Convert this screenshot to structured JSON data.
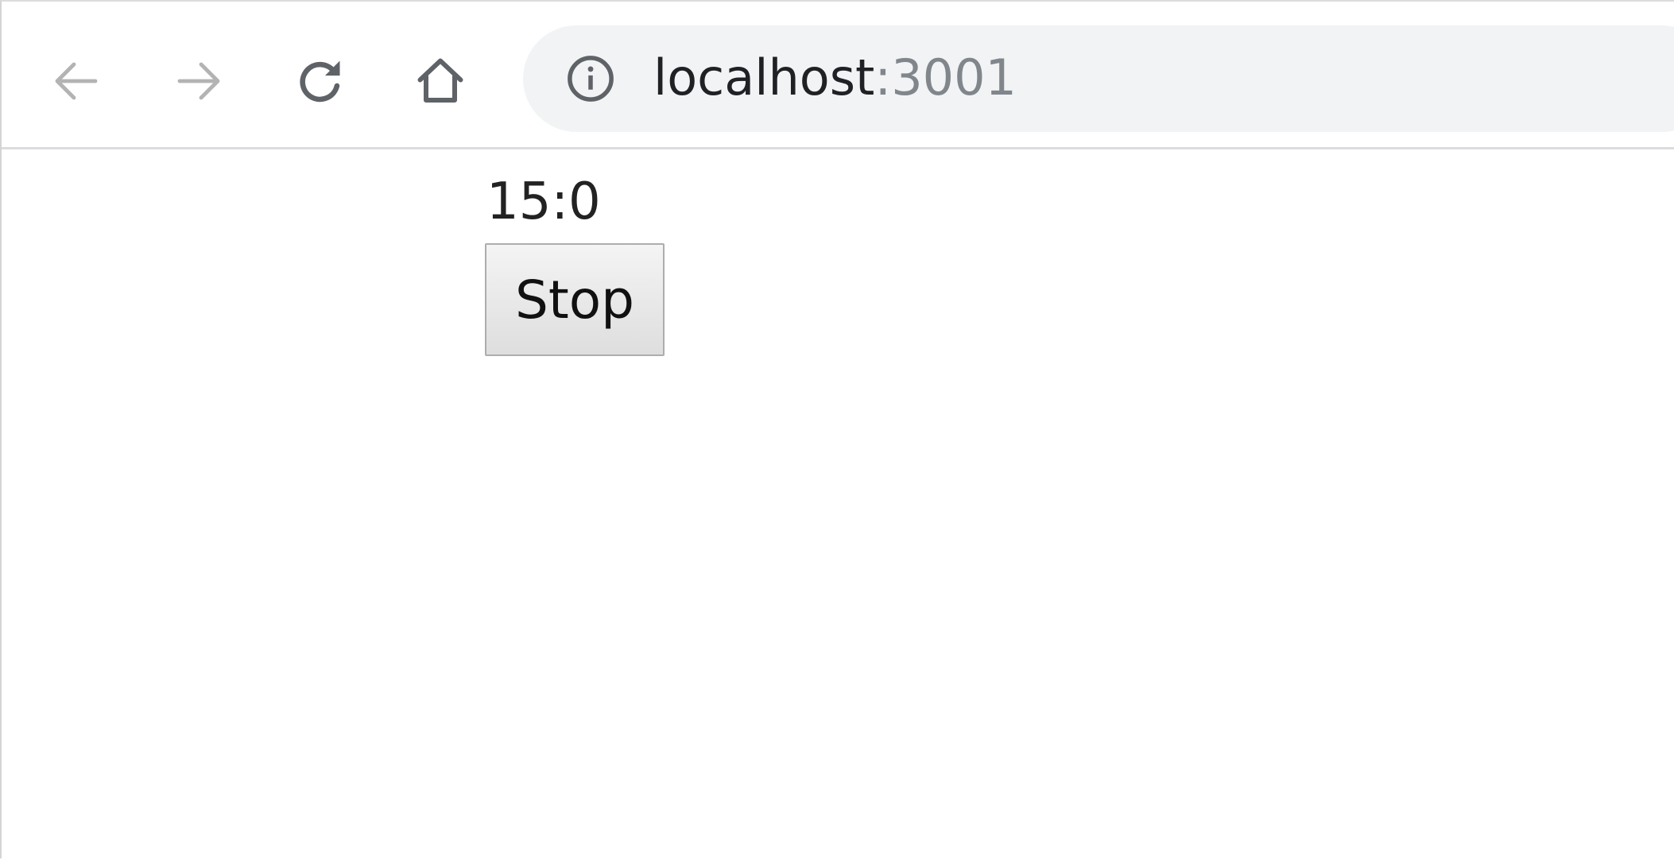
{
  "browser": {
    "url_host": "localhost",
    "url_port": ":3001",
    "icons": {
      "back": "arrow-left-icon",
      "forward": "arrow-right-icon",
      "reload": "reload-icon",
      "home": "home-icon",
      "site_info": "info-icon"
    }
  },
  "page": {
    "timer_text": "15:0",
    "stop_label": "Stop"
  }
}
